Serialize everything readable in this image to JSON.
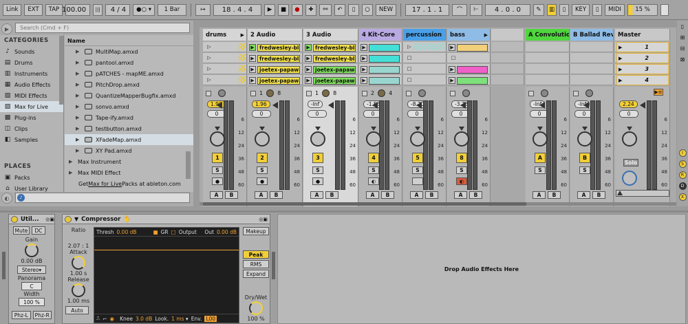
{
  "transport": {
    "link": "Link",
    "ext": "EXT",
    "tap": "TAP",
    "tempo": "100.00",
    "sig": "4 / 4",
    "quant": "1 Bar",
    "pos": "18 .  4 .  4",
    "new": "NEW",
    "loop_start": "17 .  1 .  1",
    "loop_len": "4 .  0 .  0",
    "key": "KEY",
    "midi": "MIDI",
    "cpu": "15 %"
  },
  "browser": {
    "search_placeholder": "Search (Cmd + F)",
    "categories_header": "CATEGORIES",
    "name_header": "Name",
    "categories": [
      {
        "label": "Sounds",
        "icon": "note-icon"
      },
      {
        "label": "Drums",
        "icon": "drum-icon"
      },
      {
        "label": "Instruments",
        "icon": "instrument-icon"
      },
      {
        "label": "Audio Effects",
        "icon": "audio-fx-icon"
      },
      {
        "label": "MIDI Effects",
        "icon": "midi-fx-icon"
      },
      {
        "label": "Max for Live",
        "icon": "max-icon"
      },
      {
        "label": "Plug-ins",
        "icon": "plugin-icon"
      },
      {
        "label": "Clips",
        "icon": "clip-icon"
      },
      {
        "label": "Samples",
        "icon": "sample-icon"
      }
    ],
    "places_header": "PLACES",
    "places": [
      {
        "label": "Packs"
      },
      {
        "label": "User Library"
      }
    ],
    "files": [
      "MultiMap.amxd",
      "pantool.amxd",
      "pATCHES - mapME.amxd",
      "PitchDrop.amxd",
      "QuantizeMapperBugfix.amxd",
      "sonvo.amxd",
      "Tape-ify.amxd",
      "testbutton.amxd",
      "XFadeMap.amxd",
      "XY Pad.amxd"
    ],
    "folders": [
      "Max Instrument",
      "Max MIDI Effect"
    ],
    "footer": {
      "pre": "Get ",
      "link": "Max for Live",
      "post": " Packs at ableton.com"
    }
  },
  "session": {
    "tracks": [
      {
        "name": "drums",
        "color": "#d6d6d6",
        "vol": "1.96",
        "pan": "0",
        "num": "1",
        "num_bg": "#f2cf38"
      },
      {
        "name": "2 Audio",
        "color": "#d6d6d6",
        "vol": "1.96",
        "pan": "0",
        "num": "2",
        "num_bg": "#f2cf38"
      },
      {
        "name": "3 Audio",
        "color": "#d6d6d6",
        "vol": "-Inf",
        "pan": "0",
        "num": "3",
        "num_bg": "#f2cf38"
      },
      {
        "name": "4 Kit-Core",
        "color": "#b9a9e2",
        "vol": "-1.53",
        "pan": "0",
        "num": "4",
        "num_bg": "#f2cf38"
      },
      {
        "name": "percussion",
        "color": "#4aa0e8",
        "vol": "-8.70",
        "pan": "0",
        "num": "5",
        "num_bg": "#f2cf38"
      },
      {
        "name": "bass",
        "color": "#8fbce6",
        "vol": "-3.78",
        "pan": "0",
        "num": "8",
        "num_bg": "#f2cf38"
      }
    ],
    "returns": [
      {
        "name": "A Convolutio",
        "color": "#4fd63d",
        "vol": "-Inf",
        "pan": "0",
        "num": "A"
      },
      {
        "name": "B Ballad Rev",
        "color": "#8fbce6",
        "vol": "-Inf",
        "pan": "0",
        "num": "B"
      }
    ],
    "master": {
      "name": "Master",
      "vol": "2.24",
      "pan": "0",
      "solo": "Solo",
      "scenes": [
        "1",
        "2",
        "3",
        "4"
      ]
    },
    "clips": [
      {
        "col": 1,
        "row": 0,
        "label": "fredwesley-blow",
        "color": "#f2e14a"
      },
      {
        "col": 1,
        "row": 1,
        "label": "fredwesley-blow",
        "color": "#f2e14a"
      },
      {
        "col": 1,
        "row": 2,
        "label": "joetex-papawast",
        "color": "#f2e14a"
      },
      {
        "col": 1,
        "row": 3,
        "label": "joetex-papawast",
        "color": "#f2e14a"
      },
      {
        "col": 2,
        "row": 0,
        "label": "fredwesley-blow",
        "color": "#f2e14a"
      },
      {
        "col": 2,
        "row": 1,
        "label": "fredwesley-blow",
        "color": "#f2e14a"
      },
      {
        "col": 2,
        "row": 2,
        "label": "joetex-papawast",
        "color": "#7ee05a"
      },
      {
        "col": 2,
        "row": 3,
        "label": "joetex-papawast",
        "color": "#7ee05a"
      },
      {
        "col": 3,
        "row": 0,
        "label": "",
        "color": "#44e0d8"
      },
      {
        "col": 3,
        "row": 1,
        "label": "",
        "color": "#44e0d8"
      },
      {
        "col": 3,
        "row": 2,
        "label": "",
        "color": "#9ad6d0"
      },
      {
        "col": 3,
        "row": 3,
        "label": "",
        "color": "#9ad6d0"
      },
      {
        "col": 5,
        "row": 0,
        "label": "",
        "color": "#f2d07a"
      },
      {
        "col": 5,
        "row": 2,
        "label": "",
        "color": "#f060c8"
      },
      {
        "col": 5,
        "row": 3,
        "label": "",
        "color": "#7ee07a"
      }
    ],
    "meter_scale": [
      "6",
      "12",
      "24",
      "36",
      "48",
      "60"
    ],
    "sends": [
      "1",
      "8",
      "1",
      "8",
      "2",
      "4"
    ]
  },
  "util": {
    "title": "Util...",
    "mute": "Mute",
    "dc": "DC",
    "gain_label": "Gain",
    "gain_value": "0.00 dB",
    "mode": "Stereo",
    "panorama_label": "Panorama",
    "pan_value": "C",
    "width_label": "Width",
    "width_value": "100 %",
    "phz_l": "Phz-L",
    "phz_r": "Phz-R"
  },
  "comp": {
    "title": "Compressor",
    "ratio_label": "Ratio",
    "ratio_value": "2.07 : 1",
    "attack_label": "Attack",
    "attack_value": "1.00 s",
    "release_label": "Release",
    "release_value": "1.00 ms",
    "auto": "Auto",
    "thresh_label": "Thresh",
    "thresh_value": "0.00 dB",
    "gr": "GR",
    "output": "Output",
    "out_label": "Out",
    "out_value": "0.00 dB",
    "makeup": "Makeup",
    "peak": "Peak",
    "rms": "RMS",
    "expand": "Expand",
    "drywet_label": "Dry/Wet",
    "drywet_value": "100 %",
    "knee_label": "Knee",
    "knee_value": "3.0 dB",
    "look_label": "Look.",
    "look_value": "1 ms",
    "env_label": "Env.",
    "env_value": "L00"
  },
  "drop_text": "Drop Audio Effects Here"
}
